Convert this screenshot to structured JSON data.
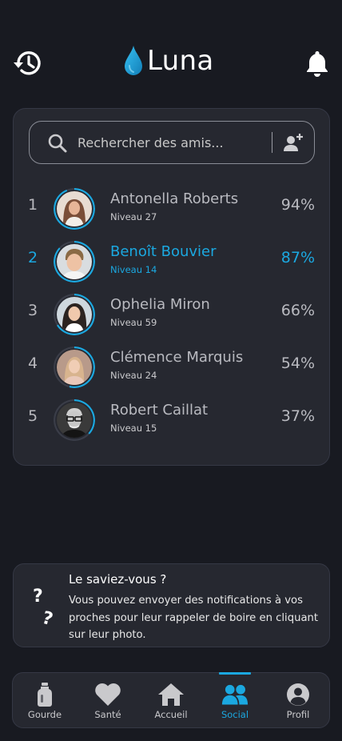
{
  "header": {
    "app_name": "Luna",
    "history_icon": "history-icon",
    "notifications_icon": "bell-icon"
  },
  "search": {
    "placeholder": "Rechercher des amis...",
    "add_friend_icon": "add-user-icon"
  },
  "ranking": [
    {
      "rank": "1",
      "name": "Antonella Roberts",
      "level": "Niveau 27",
      "percent": "94%",
      "progress": 0.94,
      "highlight": false
    },
    {
      "rank": "2",
      "name": "Benoît Bouvier",
      "level": "Niveau 14",
      "percent": "87%",
      "progress": 0.87,
      "highlight": true
    },
    {
      "rank": "3",
      "name": "Ophelia Miron",
      "level": "Niveau 59",
      "percent": "66%",
      "progress": 0.66,
      "highlight": false
    },
    {
      "rank": "4",
      "name": "Clémence Marquis",
      "level": "Niveau 24",
      "percent": "54%",
      "progress": 0.54,
      "highlight": false
    },
    {
      "rank": "5",
      "name": "Robert Caillat",
      "level": "Niveau 15",
      "percent": "37%",
      "progress": 0.37,
      "highlight": false
    }
  ],
  "tip": {
    "title": "Le saviez-vous ?",
    "body": "Vous pouvez envoyer des notifications à vos proches pour leur rappeler de boire en cliquant sur leur photo."
  },
  "nav": {
    "items": [
      {
        "label": "Gourde",
        "icon": "bottle-icon",
        "active": false
      },
      {
        "label": "Santé",
        "icon": "heart-icon",
        "active": false
      },
      {
        "label": "Accueil",
        "icon": "home-icon",
        "active": false
      },
      {
        "label": "Social",
        "icon": "users-icon",
        "active": true
      },
      {
        "label": "Profil",
        "icon": "profile-icon",
        "active": false
      }
    ]
  },
  "colors": {
    "background": "#181a21",
    "card": "#262830",
    "accent": "#1ba8e0",
    "text": "#b9bac0"
  }
}
